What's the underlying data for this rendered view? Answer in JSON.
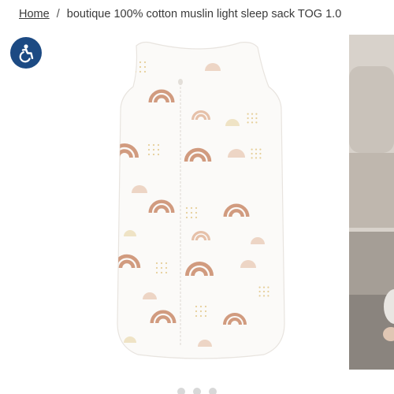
{
  "breadcrumb": {
    "home_label": "Home",
    "separator": "/",
    "current": "boutique 100% cotton muslin light sleep sack TOG 1.0"
  },
  "accessibility_button": {
    "icon": "accessibility-icon",
    "color": "#1c4a83"
  },
  "gallery": {
    "main_image_alt": "sleep sack",
    "side_image_alt": "baby wearing sleep sack",
    "pattern_colors": {
      "rainbow": "#c98a6a",
      "rainbow_light": "#e2b69b",
      "dots": "#e6cf9a"
    }
  }
}
